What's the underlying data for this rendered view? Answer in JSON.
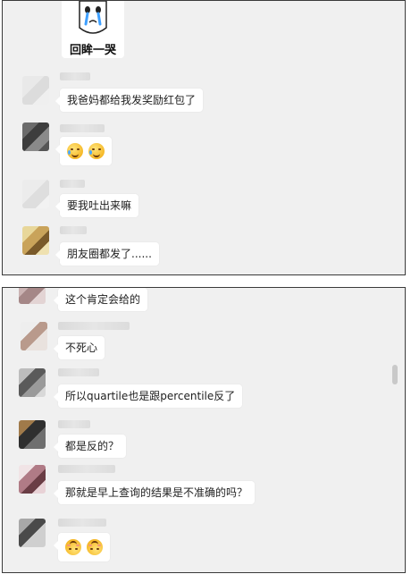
{
  "screenshot_top": {
    "sticker": {
      "caption": "回眸一哭",
      "icon": "crying-face-sticker"
    },
    "messages": [
      {
        "text": "我爸妈都给我发奖励红包了"
      },
      {
        "emojis": [
          "face-with-tears-of-joy-icon",
          "face-with-tears-of-joy-icon"
        ]
      },
      {
        "text": "要我吐出来嘛"
      },
      {
        "text": "朋友圈都发了......"
      }
    ]
  },
  "screenshot_bottom": {
    "messages": [
      {
        "text": "这个肯定会给的"
      },
      {
        "text": "不死心"
      },
      {
        "text": "所以quartile也是跟percentile反了"
      },
      {
        "text": "都是反的？"
      },
      {
        "text": "那就是早上查询的结果是不准确的吗？"
      },
      {
        "emojis": [
          "upside-down-face-icon",
          "upside-down-face-icon"
        ]
      }
    ]
  },
  "colors": {
    "chat_background": "#f0f0f0",
    "bubble": "#ffffff",
    "border": "#3a3a3a"
  }
}
